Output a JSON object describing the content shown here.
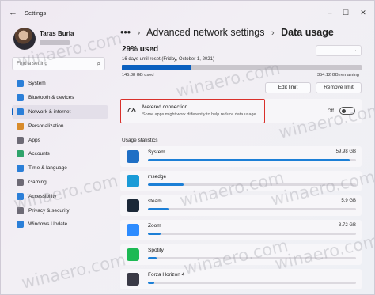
{
  "window": {
    "title": "Settings",
    "controls": {
      "minimize": "–",
      "maximize": "☐",
      "close": "✕"
    }
  },
  "user": {
    "name": "Taras Buria"
  },
  "search": {
    "placeholder": "Find a setting"
  },
  "sidebar": {
    "items": [
      {
        "label": "System",
        "icon": "monitor-icon",
        "color": "#2b7fd8"
      },
      {
        "label": "Bluetooth & devices",
        "icon": "bluetooth-icon",
        "color": "#2b7fd8"
      },
      {
        "label": "Network & internet",
        "icon": "wifi-icon",
        "color": "#2b7fd8",
        "active": true
      },
      {
        "label": "Personalization",
        "icon": "brush-icon",
        "color": "#d88b2b"
      },
      {
        "label": "Apps",
        "icon": "apps-icon",
        "color": "#6d6a75"
      },
      {
        "label": "Accounts",
        "icon": "person-icon",
        "color": "#2fa36b"
      },
      {
        "label": "Time & language",
        "icon": "globe-clock-icon",
        "color": "#2b7fd8"
      },
      {
        "label": "Gaming",
        "icon": "gamepad-icon",
        "color": "#6d6a75"
      },
      {
        "label": "Accessibility",
        "icon": "accessibility-icon",
        "color": "#2b7fd8"
      },
      {
        "label": "Privacy & security",
        "icon": "shield-icon",
        "color": "#6d6a75"
      },
      {
        "label": "Windows Update",
        "icon": "refresh-icon",
        "color": "#2b7fd8"
      }
    ]
  },
  "breadcrumb": {
    "ellipsis": "•••",
    "parent": "Advanced network settings",
    "current": "Data usage",
    "separator": "›"
  },
  "usage": {
    "percent_label": "29% used",
    "days_text": "16 days until reset (Friday, October 1, 2021)",
    "used_amount": "145.88 GB used",
    "remaining": "354.12 GB remaining",
    "fraction_used": 0.29
  },
  "buttons": {
    "edit_limit": "Edit limit",
    "remove_limit": "Remove limit"
  },
  "metered": {
    "title": "Metered connection",
    "description": "Some apps might work differently to help reduce data usage",
    "toggle_label": "Off",
    "state": false
  },
  "stats": {
    "title": "Usage statistics",
    "apps": [
      {
        "name": "System",
        "size": "59.98 GB",
        "fraction": 0.97,
        "icon": "system-icon",
        "color": "#1f6fc5"
      },
      {
        "name": "msedge",
        "size": "",
        "fraction": 0.17,
        "icon": "edge-icon",
        "color": "#1a9bd7"
      },
      {
        "name": "steam",
        "size": "5.9 GB",
        "fraction": 0.1,
        "icon": "steam-icon",
        "color": "#1b2838"
      },
      {
        "name": "Zoom",
        "size": "3.72 GB",
        "fraction": 0.06,
        "icon": "zoom-icon",
        "color": "#2d8cff"
      },
      {
        "name": "Spotify",
        "size": "",
        "fraction": 0.04,
        "icon": "spotify-icon",
        "color": "#1db954"
      },
      {
        "name": "Forza Horizon 4",
        "size": "",
        "fraction": 0.03,
        "icon": "forza-icon",
        "color": "#3a3a46"
      }
    ]
  },
  "watermark": "winaero.com"
}
